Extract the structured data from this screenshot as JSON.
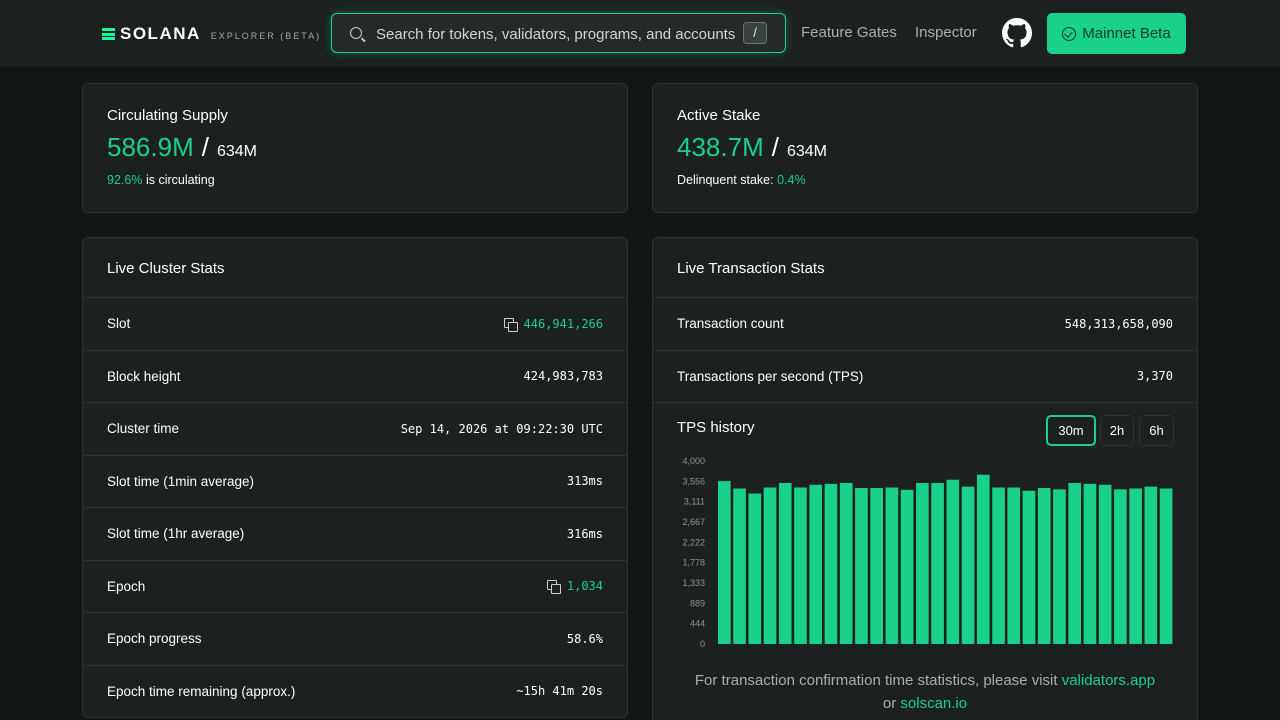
{
  "header": {
    "logo_text": "SOLANA",
    "logo_subtitle": "EXPLORER (BETA)",
    "search_placeholder": "Search for tokens, validators, programs, and accounts",
    "search_shortcut": "/",
    "nav": [
      "Feature Gates",
      "Inspector"
    ],
    "network_label": "Mainnet Beta",
    "accent": "#19d18a"
  },
  "supply": {
    "title": "Circulating Supply",
    "value": "586.9M",
    "separator": "/",
    "total": "634M",
    "percent": "92.6%",
    "percent_suffix": "is circulating"
  },
  "stake": {
    "title": "Active Stake",
    "value": "438.7M",
    "separator": "/",
    "total": "634M",
    "delinquent_label": "Delinquent stake:",
    "delinquent_value": "0.4%"
  },
  "cluster": {
    "title": "Live Cluster Stats",
    "rows": [
      {
        "label": "Slot",
        "value": "446,941,266",
        "copy": true
      },
      {
        "label": "Block height",
        "value": "424,983,783",
        "copy": false
      },
      {
        "label": "Cluster time",
        "value": "Sep 14, 2026 at 09:22:30 UTC",
        "copy": false
      },
      {
        "label": "Slot time (1min average)",
        "value": "313ms",
        "copy": false
      },
      {
        "label": "Slot time (1hr average)",
        "value": "316ms",
        "copy": false
      },
      {
        "label": "Epoch",
        "value": "1,034",
        "copy": true
      },
      {
        "label": "Epoch progress",
        "value": "58.6%",
        "copy": false
      },
      {
        "label": "Epoch time remaining (approx.)",
        "value": "~15h 41m 20s",
        "copy": false
      }
    ]
  },
  "transactions": {
    "title": "Live Transaction Stats",
    "rows": [
      {
        "label": "Transaction count",
        "value": "548,313,658,090"
      },
      {
        "label": "Transactions per second (TPS)",
        "value": "3,370"
      }
    ],
    "tps_history_title": "TPS history",
    "ranges": [
      "30m",
      "2h",
      "6h"
    ],
    "active_range": "30m",
    "footnote_text": "For transaction confirmation time statistics, please visit",
    "footnote_link1": "validators.app",
    "footnote_or": "or",
    "footnote_link2": "solscan.io"
  },
  "chart_data": {
    "type": "bar",
    "title": "",
    "xlabel": "",
    "ylabel": "",
    "ylim": [
      0,
      4000
    ],
    "yticks": [
      "4,000",
      "3,556",
      "3,111",
      "2,667",
      "2,222",
      "1,778",
      "1,333",
      "889",
      "444",
      "0"
    ],
    "values": [
      3560,
      3400,
      3290,
      3420,
      3520,
      3420,
      3480,
      3500,
      3520,
      3410,
      3410,
      3420,
      3370,
      3520,
      3520,
      3590,
      3440,
      3700,
      3420,
      3420,
      3350,
      3410,
      3380,
      3520,
      3500,
      3480,
      3380,
      3400,
      3440,
      3400
    ],
    "bar_color": "#19d18a",
    "grid": false,
    "legend": "none"
  }
}
